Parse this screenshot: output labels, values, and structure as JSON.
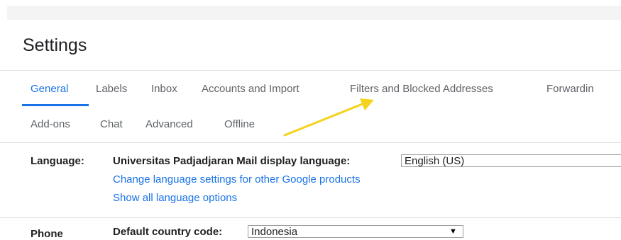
{
  "page": {
    "title": "Settings"
  },
  "tabs": [
    {
      "label": "General",
      "active": true
    },
    {
      "label": "Labels"
    },
    {
      "label": "Inbox"
    },
    {
      "label": "Accounts and Import"
    },
    {
      "label": "Filters and Blocked Addresses"
    },
    {
      "label": "Forwardin"
    },
    {
      "label": "Add-ons"
    },
    {
      "label": "Chat"
    },
    {
      "label": "Advanced"
    },
    {
      "label": "Offline"
    }
  ],
  "language": {
    "label": "Language:",
    "display_label": "Universitas Padjadjaran Mail display language:",
    "display_value": "English (US)",
    "link_change": "Change language settings for other Google products",
    "link_show_all": "Show all language options"
  },
  "phone": {
    "label": "Phone",
    "country_label": "Default country code:",
    "country_value": "Indonesia"
  },
  "annotation": {
    "arrow_color": "#f5d21c",
    "icon": "yellow-pointer-arrow"
  },
  "colors": {
    "accent": "#1a73e8",
    "text": "#202124",
    "muted": "#5f6368"
  }
}
